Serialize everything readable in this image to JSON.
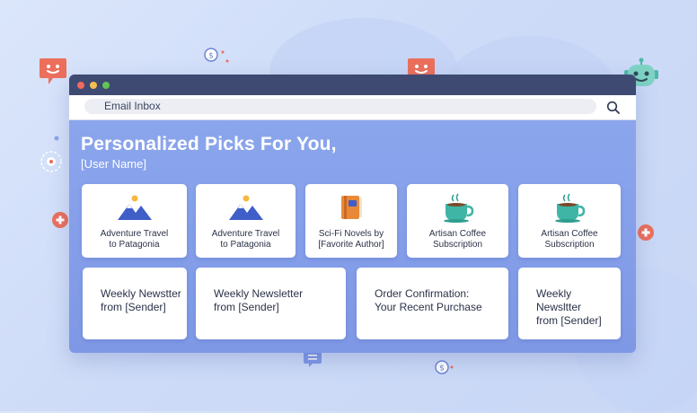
{
  "window": {
    "address_bar_text": "Email Inbox"
  },
  "heading": "Personalized Picks For You,",
  "subheading": "[User Name]",
  "row1_cards": [
    {
      "title": "Adventure Travel\nto Patagonia",
      "icon": "mountain-icon"
    },
    {
      "title": "Adventure Travel\nto Patagonia",
      "icon": "mountain-icon"
    },
    {
      "title": "Sci-Fi Novels by\n[Favorite Author]",
      "icon": "book-icon"
    },
    {
      "title": "Artisan Coffee\nSubscription",
      "icon": "coffee-cup-icon"
    },
    {
      "title": "Artisan Coffee\nSubscription",
      "icon": "coffee-cup-icon"
    }
  ],
  "row2_cards": [
    {
      "title": "Weekly Newstter\nfrom [Sender]"
    },
    {
      "title": "Weekly Newsletter\nfrom [Sender]"
    },
    {
      "title": "Order Confirmation:\nYour Recent Purchase"
    },
    {
      "title": "Weekly Newsltter\nfrom [Sender]"
    }
  ],
  "colors": {
    "background": "#d3dffa",
    "titlebar": "#3f4a72",
    "panel": "#879fea",
    "accent_red": "#ec6f5c",
    "bot_teal": "#7fd3c4"
  }
}
